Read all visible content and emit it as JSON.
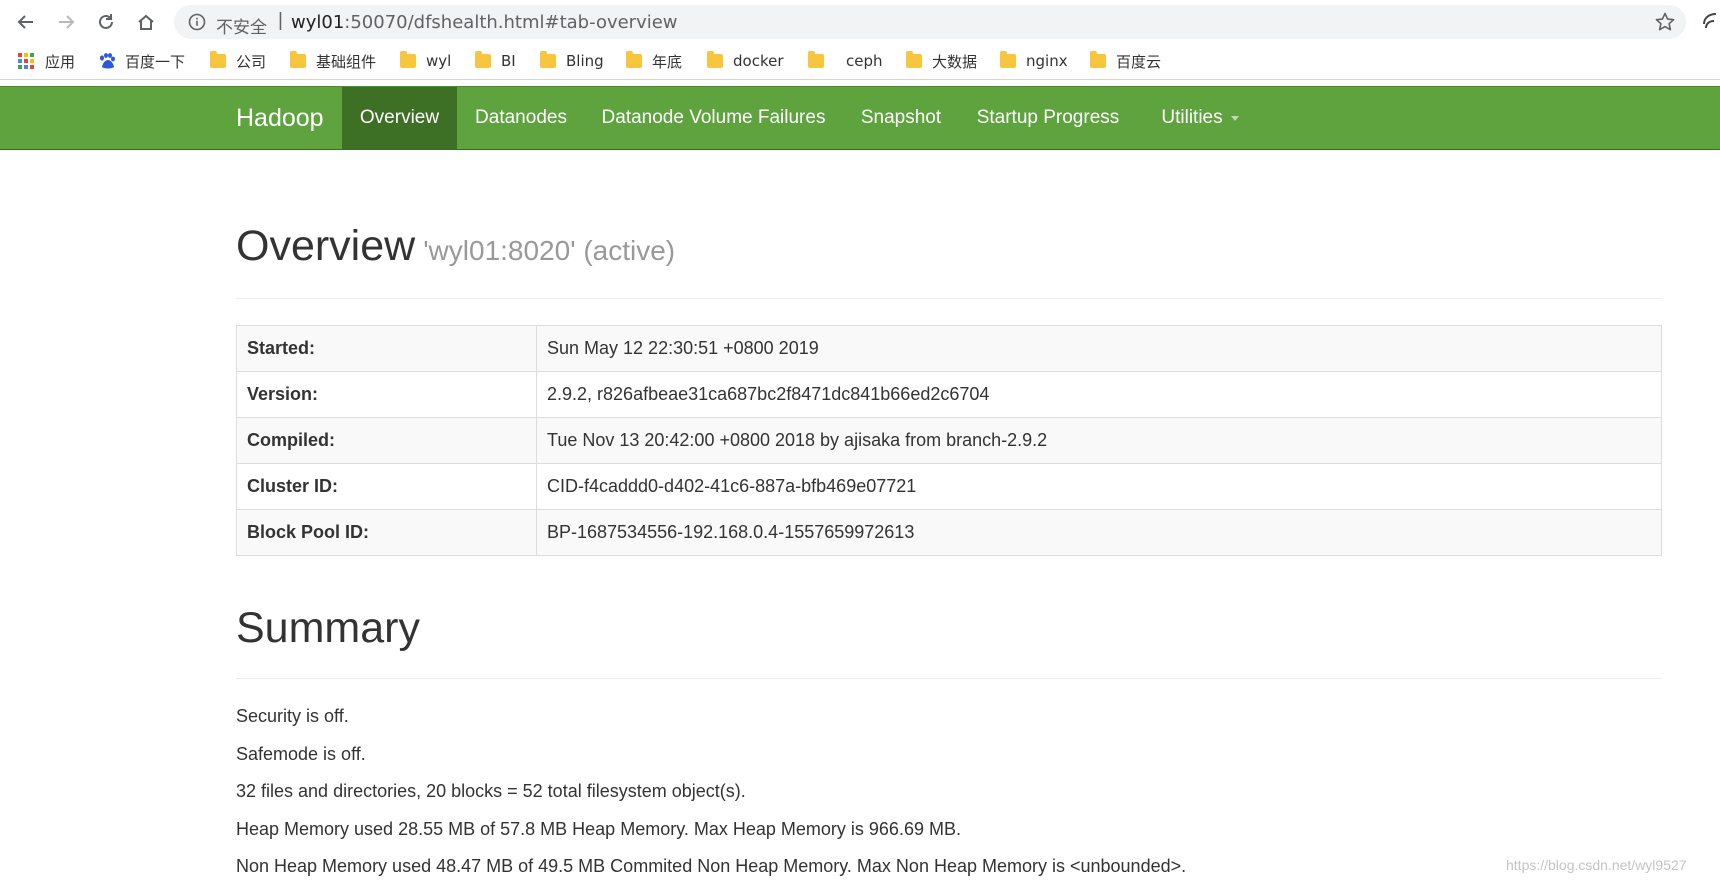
{
  "browser": {
    "security_label": "不安全",
    "separator": "|",
    "url_host": "wyl01",
    "url_rest": ":50070/dfshealth.html#tab-overview"
  },
  "bookmarks": [
    {
      "label": "应用",
      "icon": "apps-grid-icon"
    },
    {
      "label": "百度一下",
      "icon": "baidu-paw-icon"
    },
    {
      "label": "公司",
      "icon": "folder-icon"
    },
    {
      "label": "基础组件",
      "icon": "folder-icon"
    },
    {
      "label": "wyl",
      "icon": "folder-icon"
    },
    {
      "label": "BI",
      "icon": "folder-icon"
    },
    {
      "label": "Bling",
      "icon": "folder-icon"
    },
    {
      "label": "年底",
      "icon": "folder-icon"
    },
    {
      "label": "docker",
      "icon": "folder-icon"
    },
    {
      "label": "",
      "icon": "folder-icon"
    },
    {
      "label": "ceph",
      "icon": ""
    },
    {
      "label": "大数据",
      "icon": "folder-icon"
    },
    {
      "label": "nginx",
      "icon": "folder-icon"
    },
    {
      "label": "百度云",
      "icon": "folder-icon"
    }
  ],
  "navbar": {
    "brand": "Hadoop",
    "tabs": [
      "Overview",
      "Datanodes",
      "Datanode Volume Failures",
      "Snapshot",
      "Startup Progress",
      "Utilities"
    ],
    "active_tab": "Overview",
    "color": "#5fa33e",
    "active_color": "#3d6f25"
  },
  "overview": {
    "title": "Overview",
    "subtitle": "'wyl01:8020' (active)",
    "rows": [
      {
        "key": "Started:",
        "value": "Sun May 12 22:30:51 +0800 2019"
      },
      {
        "key": "Version:",
        "value": "2.9.2, r826afbeae31ca687bc2f8471dc841b66ed2c6704"
      },
      {
        "key": "Compiled:",
        "value": "Tue Nov 13 20:42:00 +0800 2018 by ajisaka from branch-2.9.2"
      },
      {
        "key": "Cluster ID:",
        "value": "CID-f4caddd0-d402-41c6-887a-bfb469e07721"
      },
      {
        "key": "Block Pool ID:",
        "value": "BP-1687534556-192.168.0.4-1557659972613"
      }
    ]
  },
  "summary": {
    "title": "Summary",
    "lines": [
      "Security is off.",
      "Safemode is off.",
      "32 files and directories, 20 blocks = 52 total filesystem object(s).",
      "Heap Memory used 28.55 MB of 57.8 MB Heap Memory. Max Heap Memory is 966.69 MB.",
      "Non Heap Memory used 48.47 MB of 49.5 MB Commited Non Heap Memory. Max Non Heap Memory is <unbounded>."
    ]
  },
  "watermark": "https://blog.csdn.net/wyl9527"
}
